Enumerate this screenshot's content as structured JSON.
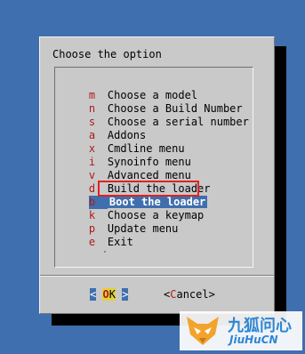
{
  "dialog": {
    "title": "Choose the option"
  },
  "menu": {
    "items": [
      {
        "key": "m",
        "label": "Choose a model"
      },
      {
        "key": "n",
        "label": "Choose a Build Number"
      },
      {
        "key": "s",
        "label": "Choose a serial number"
      },
      {
        "key": "a",
        "label": "Addons"
      },
      {
        "key": "x",
        "label": "Cmdline menu"
      },
      {
        "key": "i",
        "label": "Synoinfo menu"
      },
      {
        "key": "v",
        "label": "Advanced menu"
      },
      {
        "key": "d",
        "label": "Build the loader"
      },
      {
        "key": "b",
        "label": "Boot the loader"
      },
      {
        "key": "k",
        "label": "Choose a keymap"
      },
      {
        "key": "p",
        "label": "Update menu"
      },
      {
        "key": "e",
        "label": "Exit"
      }
    ],
    "selected_index": 8
  },
  "buttons": {
    "ok_left": "<",
    "ok_hot": "O",
    "ok_rest": "K",
    "ok_right": ">",
    "cancel_left": "<",
    "cancel_hot": "C",
    "cancel_rest": "ancel",
    "cancel_right": ">"
  },
  "watermark": {
    "cn": "九狐问心",
    "en": "JiuHuCN"
  },
  "colors": {
    "background": "#3f6fae",
    "dialog": "#c9c9c9",
    "hotkey": "#b11a1a",
    "selection": "#3f6fae",
    "annotation": "#e32121"
  }
}
